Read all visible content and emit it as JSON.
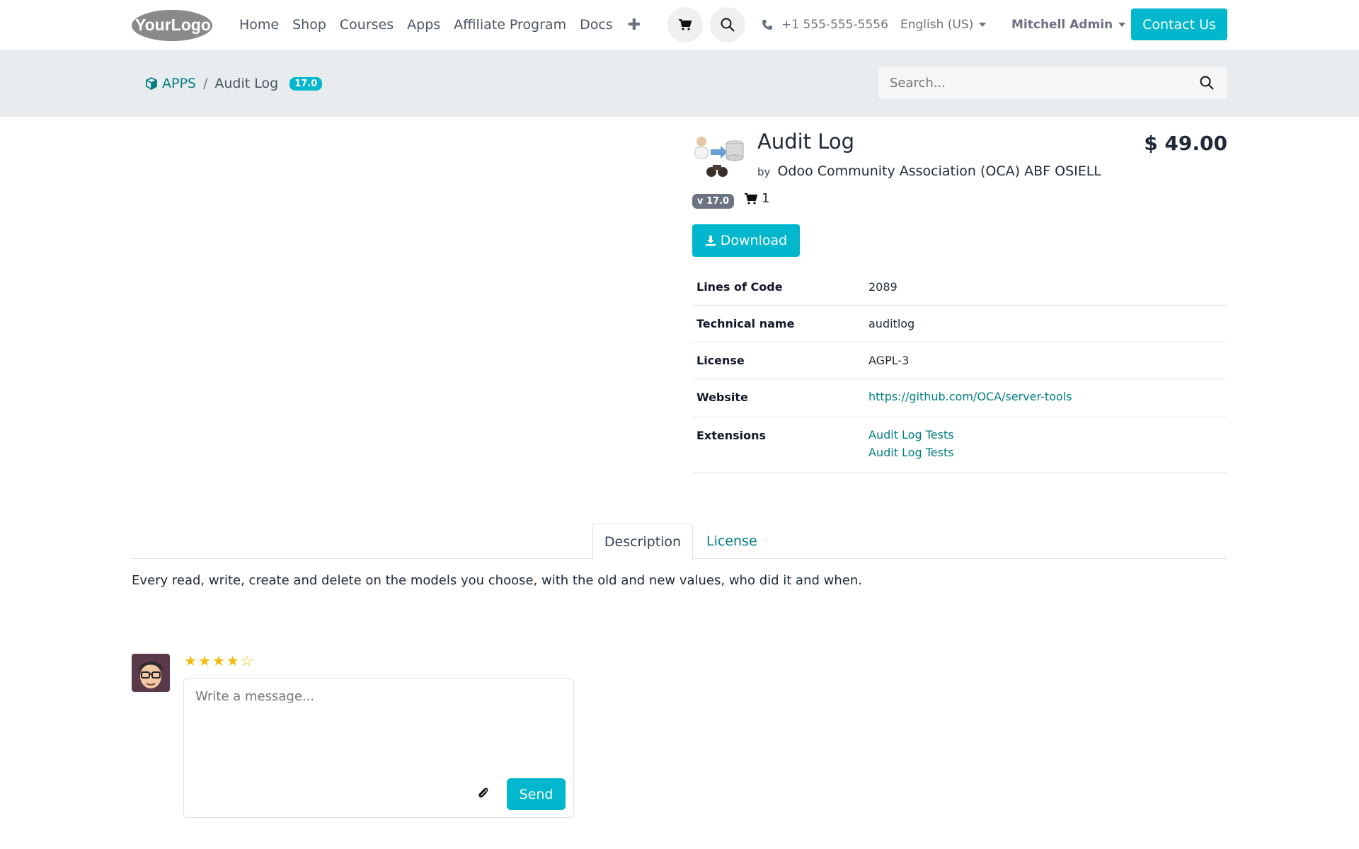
{
  "header": {
    "logo_text": "YourLogo",
    "nav": [
      "Home",
      "Shop",
      "Courses",
      "Apps",
      "Affiliate Program",
      "Docs"
    ],
    "plus_icon": "plus-icon",
    "cart_icon": "cart-icon",
    "search_icon": "search-icon",
    "phone": "+1 555-555-5556",
    "language": "English (US)",
    "user": "Mitchell Admin",
    "contact_label": "Contact Us"
  },
  "breadcrumb": {
    "root": "APPS",
    "current": "Audit Log",
    "version_badge": "17.0"
  },
  "search": {
    "placeholder": "Search..."
  },
  "product": {
    "title": "Audit Log",
    "by_prefix": "by",
    "author": "Odoo Community Association (OCA) ABF OSIELL",
    "price": "$ 49.00",
    "version": "v 17.0",
    "cart_count": "1",
    "download_label": "Download"
  },
  "info": {
    "lines_label": "Lines of Code",
    "lines_value": "2089",
    "tech_label": "Technical name",
    "tech_value": "auditlog",
    "license_label": "License",
    "license_value": "AGPL-3",
    "website_label": "Website",
    "website_value": "https://github.com/OCA/server-tools",
    "extensions_label": "Extensions",
    "extensions": [
      "Audit Log Tests",
      "Audit Log Tests"
    ]
  },
  "tabs": {
    "description": "Description",
    "license": "License"
  },
  "description": "Every read, write, create and delete on the models you choose, with the old and new values, who did it and when.",
  "review": {
    "rating": 4,
    "max": 5,
    "placeholder": "Write a message...",
    "send_label": "Send"
  },
  "colors": {
    "accent": "#00b7cd",
    "link": "#017e84",
    "star": "#f5b90a"
  }
}
